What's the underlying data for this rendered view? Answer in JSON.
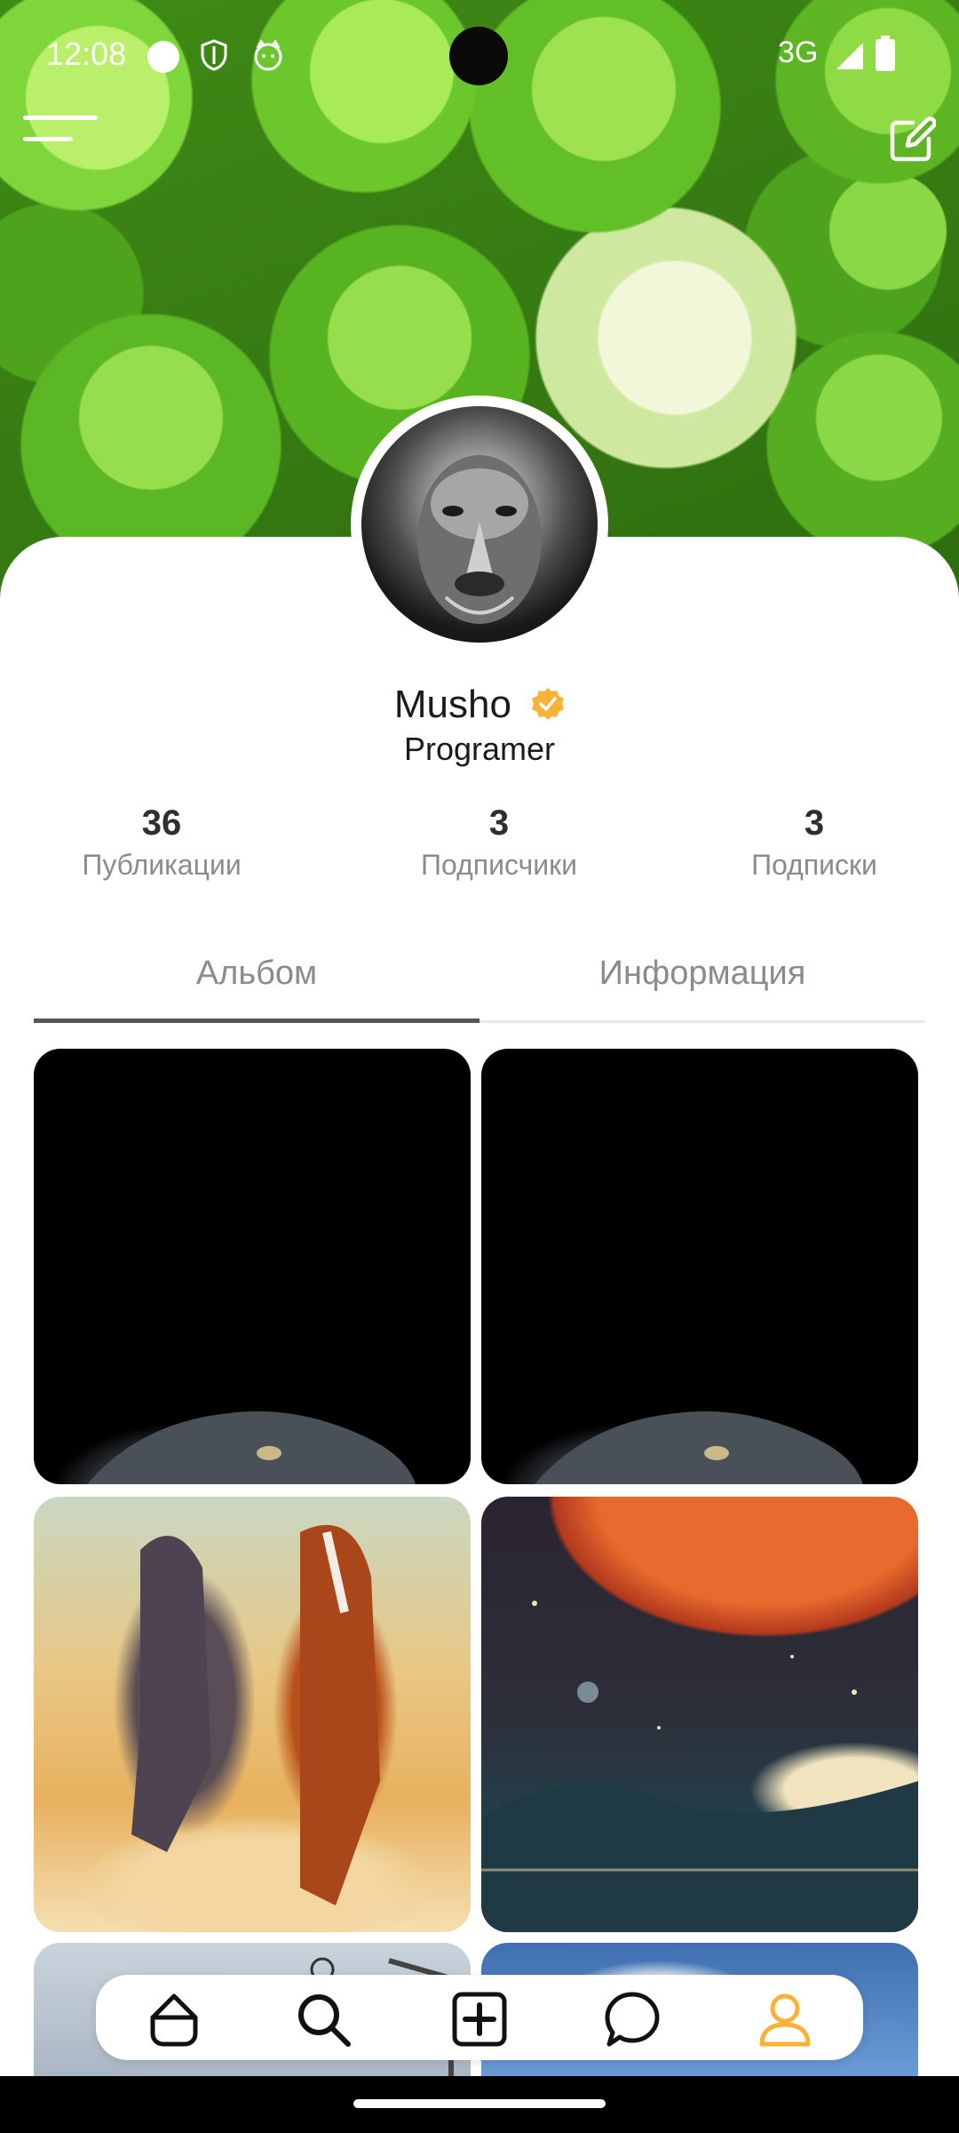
{
  "status_bar": {
    "time": "12:08",
    "network": "3G"
  },
  "profile": {
    "name": "Musho",
    "role": "Programer",
    "verified_color": "#F9B233",
    "stats": [
      {
        "value": "36",
        "label": "Публикации"
      },
      {
        "value": "3",
        "label": "Подписчики"
      },
      {
        "value": "3",
        "label": "Подписки"
      }
    ]
  },
  "tabs": [
    {
      "label": "Альбом",
      "active": true
    },
    {
      "label": "Информация",
      "active": false
    }
  ],
  "album": [
    {
      "image": "cat-in-dark"
    },
    {
      "image": "cat-in-dark"
    },
    {
      "image": "painted-horses"
    },
    {
      "image": "space-planet-art"
    },
    {
      "image": "sky-with-lamp"
    },
    {
      "image": "blue-sky-clouds"
    }
  ],
  "bottom_nav": [
    {
      "icon": "home-icon",
      "active": false
    },
    {
      "icon": "search-icon",
      "active": false
    },
    {
      "icon": "add-post-icon",
      "active": false
    },
    {
      "icon": "chat-icon",
      "active": false
    },
    {
      "icon": "profile-icon",
      "active": true
    }
  ],
  "colors": {
    "accent": "#F9B233",
    "text_dark": "#1B1B1B",
    "text_muted": "#8B8B8B"
  }
}
